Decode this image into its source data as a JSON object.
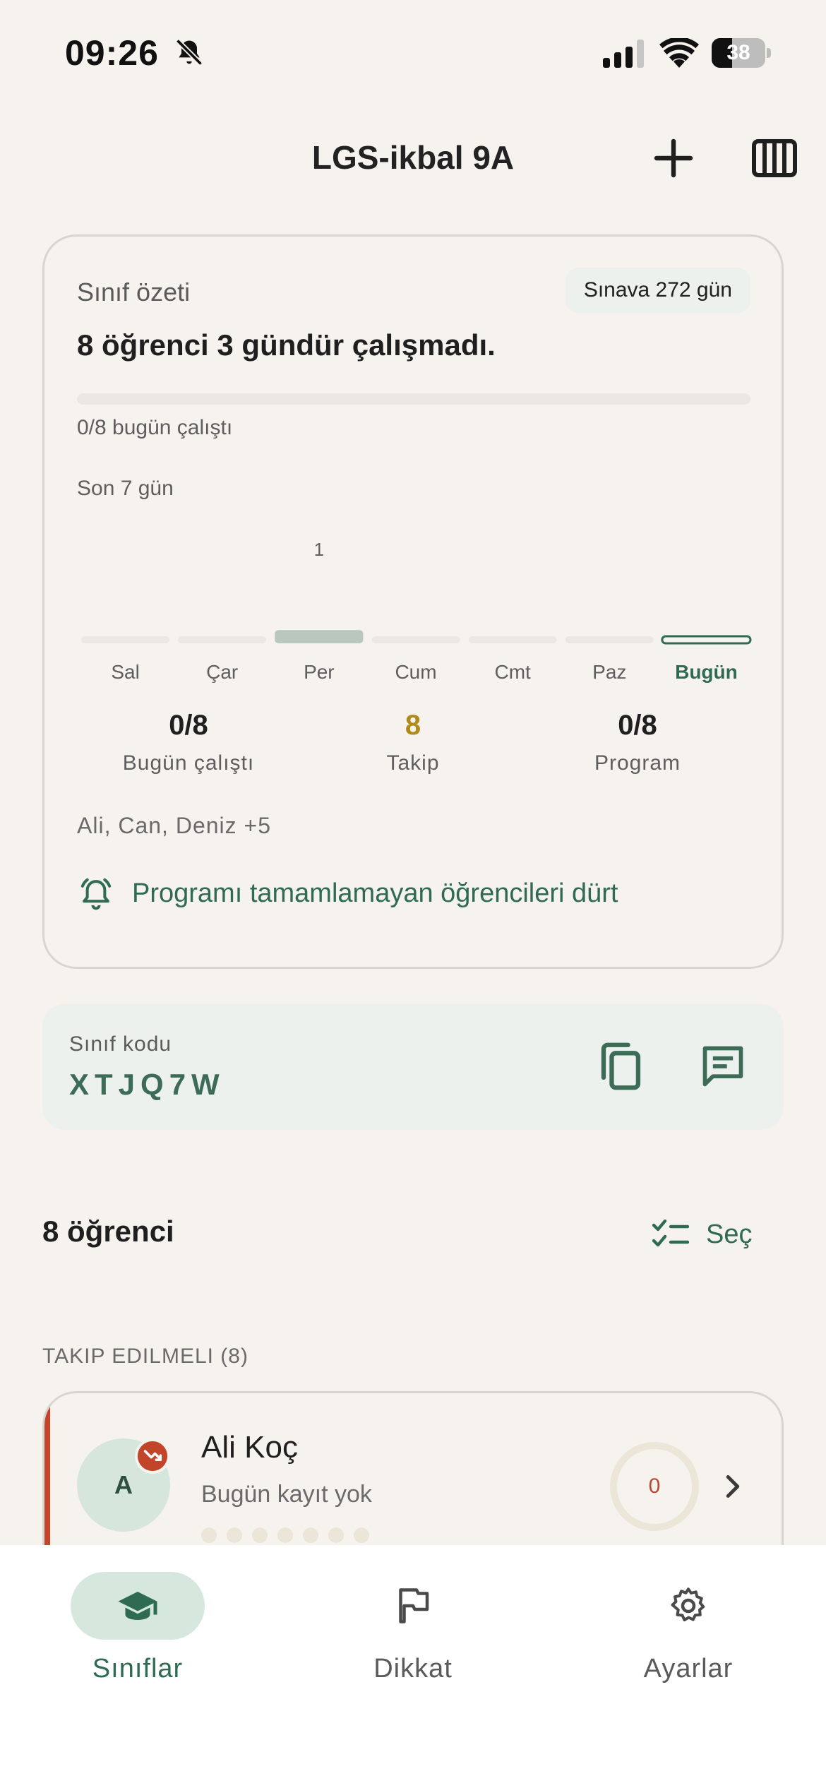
{
  "status_bar": {
    "time": "09:26",
    "battery_level": "38",
    "battery_fraction": 0.38
  },
  "header": {
    "title": "LGS-ikbal 9A",
    "add_icon": "plus-icon",
    "layout_icon": "grid-columns-icon"
  },
  "summary": {
    "label": "Sınıf özeti",
    "exam_badge": "Sınava 272 gün",
    "headline": "8 öğrenci 3 gündür çalışmadı.",
    "progress_fraction": 0,
    "progress_text": "0/8 bugün çalıştı",
    "chart_label": "Son 7 gün",
    "stats": [
      {
        "value": "0/8",
        "label": "Bugün çalıştı"
      },
      {
        "value": "8",
        "label": "Takip"
      },
      {
        "value": "0/8",
        "label": "Program"
      }
    ],
    "names": "Ali, Can, Deniz +5",
    "nudge_label": "Programı tamamlamayan öğrencileri dürt",
    "nudge_icon": "alarm-bell-icon"
  },
  "chart_data": {
    "type": "bar",
    "categories": [
      "Sal",
      "Çar",
      "Per",
      "Cum",
      "Cmt",
      "Paz",
      "Bugün"
    ],
    "values": [
      0,
      0,
      1,
      0,
      0,
      0,
      0
    ],
    "data_labels": [
      "",
      "",
      "1",
      "",
      "",
      "",
      ""
    ],
    "highlight_category": "Bugün",
    "ylim": [
      0,
      8
    ],
    "colors": {
      "filled": "#b9c7bd",
      "empty": "#ebe8e3",
      "today": "#2f6a52"
    }
  },
  "class_code": {
    "label": "Sınıf kodu",
    "value": "XTJQ7W",
    "copy_icon": "copy-icon",
    "share_icon": "message-icon"
  },
  "students": {
    "count_label": "8 öğrenci",
    "select_label": "Seç",
    "section_label": "TAKIP EDILMELI (8)",
    "items": [
      {
        "initial": "A",
        "name": "Ali Koç",
        "status": "Bugün kayıt yok",
        "score": "0",
        "score_fraction": 0,
        "week_dots": 7,
        "trend_icon": "trending-down-icon"
      }
    ]
  },
  "nav": {
    "items": [
      {
        "label": "Sınıflar",
        "icon": "graduation-cap-icon",
        "active": true
      },
      {
        "label": "Dikkat",
        "icon": "flag-icon",
        "active": false
      },
      {
        "label": "Ayarlar",
        "icon": "gear-icon",
        "active": false
      }
    ]
  },
  "colors": {
    "background": "#f6f3ef",
    "accent": "#2f6a52",
    "warning": "#b28a1c",
    "alert": "#c2452a"
  }
}
